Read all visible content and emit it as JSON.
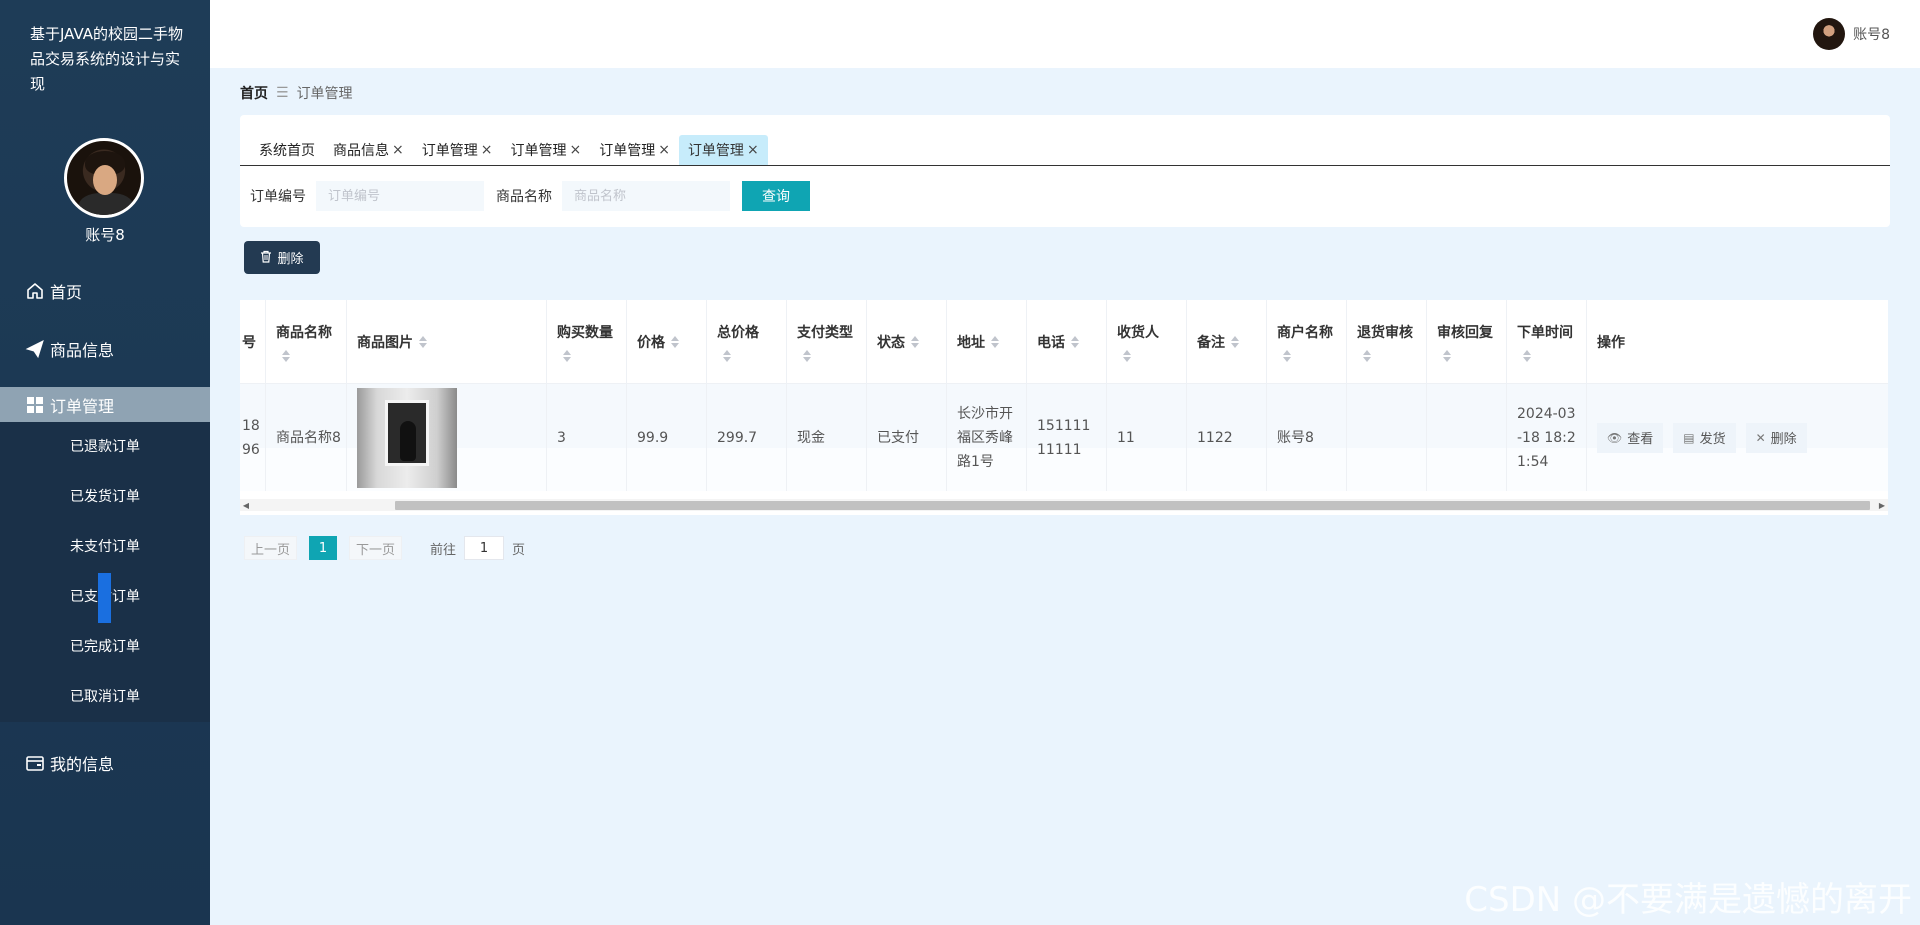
{
  "sidebar": {
    "system_title": "基于JAVA的校园二手物品交易系统的设计与实现",
    "user_name": "账号8",
    "menu": {
      "home": "首页",
      "goods": "商品信息",
      "orders": "订单管理",
      "my_info": "我的信息"
    },
    "submenu": [
      "已退款订单",
      "已发货订单",
      "未支付订单",
      "已支付订单",
      "已完成订单",
      "已取消订单"
    ]
  },
  "topbar": {
    "user_name": "账号8"
  },
  "breadcrumb": {
    "home": "首页",
    "current": "订单管理"
  },
  "tabs": [
    {
      "label": "系统首页",
      "closable": false
    },
    {
      "label": "商品信息",
      "closable": true
    },
    {
      "label": "订单管理",
      "closable": true
    },
    {
      "label": "订单管理",
      "closable": true
    },
    {
      "label": "订单管理",
      "closable": true
    },
    {
      "label": "订单管理",
      "closable": true
    }
  ],
  "tab_close": "×",
  "search": {
    "order_no_label": "订单编号",
    "order_no_placeholder": "订单编号",
    "goods_name_label": "商品名称",
    "goods_name_placeholder": "商品名称",
    "query_label": "查询"
  },
  "toolbar": {
    "delete_label": "删除"
  },
  "table": {
    "headers": {
      "order_no": "号",
      "goods_name": "商品名称",
      "goods_image": "商品图片",
      "quantity": "购买数量",
      "price": "价格",
      "total": "总价格",
      "pay_type": "支付类型",
      "status": "状态",
      "address": "地址",
      "phone": "电话",
      "receiver": "收货人",
      "remark": "备注",
      "merchant": "商户名称",
      "refund_review": "退货审核",
      "review_reply": "审核回复",
      "order_time": "下单时间",
      "actions": "操作"
    },
    "row": {
      "order_no": "18\n96",
      "goods_name": "商品名称8",
      "quantity": "3",
      "price": "99.9",
      "total": "299.7",
      "pay_type": "现金",
      "status": "已支付",
      "address": "长沙市开福区秀峰路1号",
      "phone": "15111111111",
      "receiver": "11",
      "remark": "1122",
      "merchant": "账号8",
      "refund_review": "",
      "review_reply": "",
      "order_time": "2024-03-18 18:21:54"
    },
    "actions": {
      "view": "查看",
      "ship": "发货",
      "delete": "删除"
    }
  },
  "pagination": {
    "prev": "上一页",
    "current_page": "1",
    "next": "下一页",
    "goto_prefix": "前往",
    "goto_value": "1",
    "goto_suffix": "页"
  },
  "watermark": "CSDN @不要满是遗憾的离开",
  "colors": {
    "sidebar_bg": "#1e3c57",
    "accent": "#0fa5b3",
    "active_tab": "#c7ecfb",
    "page_bg": "#eaf4fd"
  }
}
